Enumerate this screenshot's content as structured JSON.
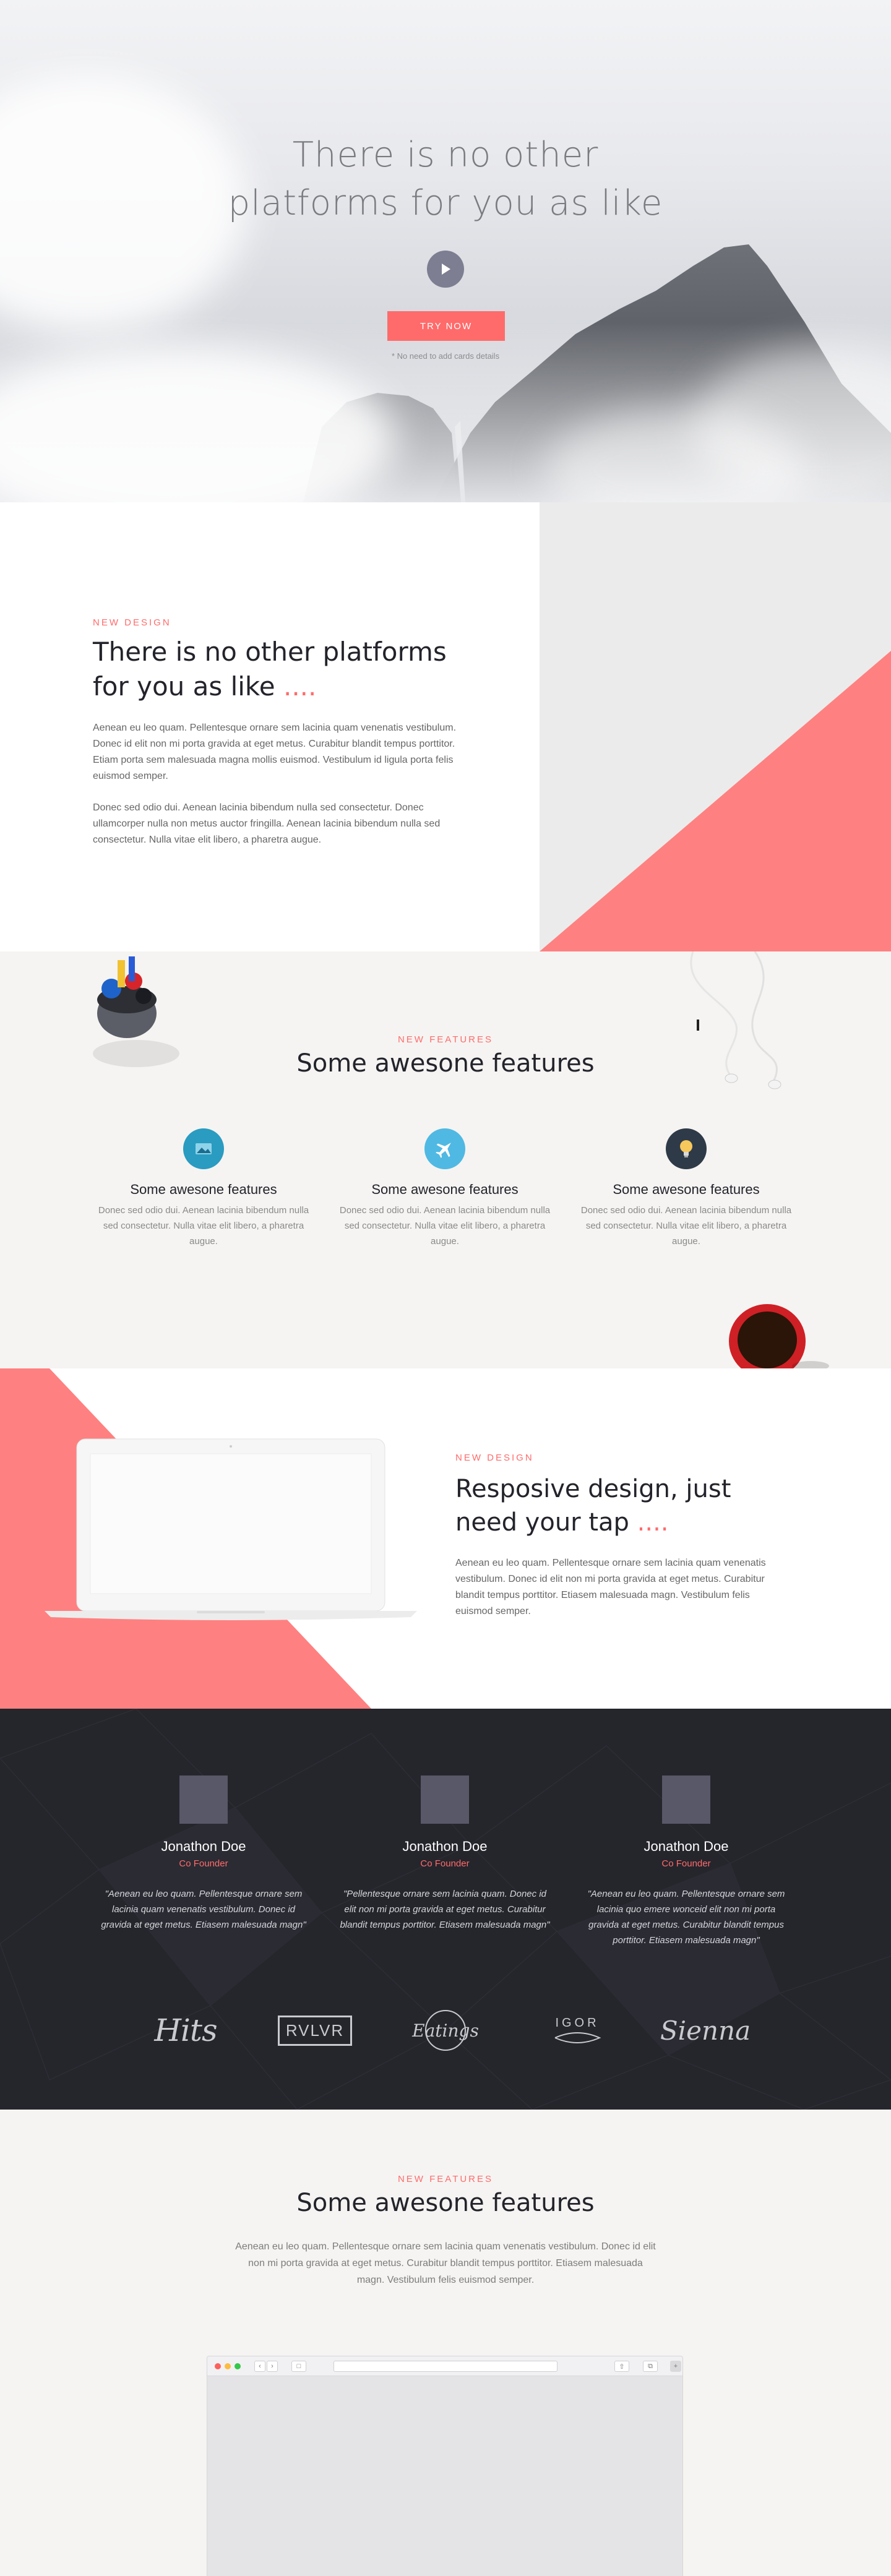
{
  "hero": {
    "title_line1": "There is no other",
    "title_line2": "platforms for you as like",
    "cta_label": "TRY NOW",
    "note": "* No need to add cards details"
  },
  "intro": {
    "eyebrow": "NEW DESIGN",
    "title": "There is no other platforms for you as like",
    "title_dots": "....",
    "paragraph1": "Aenean eu leo quam. Pellentesque ornare sem lacinia quam venenatis vestibulum. Donec id elit non mi porta gravida at eget metus. Curabitur blandit tempus porttitor. Etiam porta sem malesuada magna mollis euismod. Vestibulum id ligula porta felis euismod semper.",
    "paragraph2": "Donec sed odio dui. Aenean lacinia bibendum nulla sed consectetur. Donec ullamcorper nulla non metus auctor fringilla. Aenean lacinia bibendum nulla sed consectetur. Nulla vitae elit libero, a pharetra augue."
  },
  "features": {
    "eyebrow": "NEW FEATURES",
    "title": "Some awesone features",
    "items": [
      {
        "icon": "image-icon",
        "color": "#2a9bc1",
        "title": "Some awesone features",
        "text": "Donec sed odio dui. Aenean lacinia bibendum nulla sed consectetur. Nulla vitae elit libero, a pharetra augue."
      },
      {
        "icon": "airplane-icon",
        "color": "#4fb9e3",
        "title": "Some awesone features",
        "text": "Donec sed odio dui. Aenean lacinia bibendum nulla sed consectetur. Nulla vitae elit libero, a pharetra augue."
      },
      {
        "icon": "lightbulb-icon",
        "color": "#2f3a48",
        "title": "Some awesone features",
        "text": "Donec sed odio dui. Aenean lacinia bibendum nulla sed consectetur. Nulla vitae elit libero, a pharetra augue."
      }
    ]
  },
  "responsive": {
    "eyebrow": "NEW DESIGN",
    "title": "Resposive design, just need your tap",
    "title_dots": "....",
    "paragraph": "Aenean eu leo quam. Pellentesque ornare sem lacinia quam venenatis vestibulum. Donec id elit non mi porta gravida at eget metus. Curabitur blandit tempus porttitor. Etiasem malesuada magn. Vestibulum felis euismod semper."
  },
  "testimonials": [
    {
      "name": "Jonathon Doe",
      "role": "Co Founder",
      "quote": "\"Aenean eu leo quam. Pellentesque ornare sem lacinia quam venenatis vestibulum. Donec id gravida at eget metus. Etiasem malesuada magn\""
    },
    {
      "name": "Jonathon Doe",
      "role": "Co Founder",
      "quote": "\"Pellentesque ornare sem lacinia quam. Donec id elit non mi porta gravida at eget metus. Curabitur blandit tempus porttitor. Etiasem malesuada magn\""
    },
    {
      "name": "Jonathon Doe",
      "role": "Co Founder",
      "quote": "\"Aenean eu leo quam. Pellentesque ornare sem lacinia quo emere wonceid elit non mi porta gravida at eget metus. Curabitur blandit tempus porttitor. Etiasem malesuada magn\""
    }
  ],
  "logos": [
    "Hits",
    "RVLVR",
    "Eatings",
    "IGOR",
    "Sienna"
  ],
  "final": {
    "eyebrow": "NEW FEATURES",
    "title": "Some awesone features",
    "paragraph": "Aenean eu leo quam. Pellentesque ornare sem lacinia quam venenatis vestibulum. Donec id elit non mi porta gravida at eget metus. Curabitur blandit tempus porttitor. Etiasem malesuada magn. Vestibulum felis euismod semper."
  },
  "colors": {
    "accent": "#ff6b6b",
    "coral_shape": "#ff8080",
    "dark_bg": "#25252c",
    "muted_button": "#7d7e91"
  }
}
